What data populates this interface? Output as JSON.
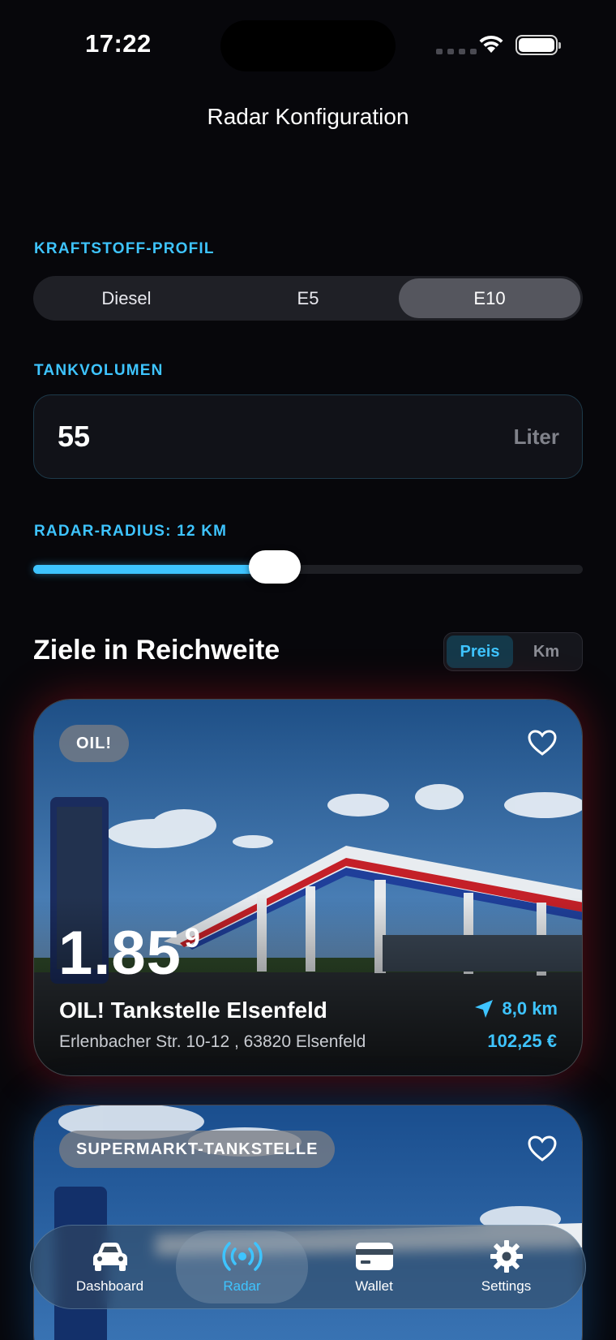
{
  "status_bar": {
    "time": "17:22"
  },
  "header": {
    "title": "Radar Konfiguration"
  },
  "fuel_profile": {
    "label": "KRAFTSTOFF-PROFIL",
    "options": [
      "Diesel",
      "E5",
      "E10"
    ],
    "selected": "E10"
  },
  "tank": {
    "label": "TANKVOLUMEN",
    "value": "55",
    "unit": "Liter"
  },
  "radius": {
    "label": "RADAR-RADIUS: 12 KM",
    "fill_fraction": 0.44
  },
  "targets": {
    "title": "Ziele in Reichweite",
    "sort_options": [
      "Preis",
      "Km"
    ],
    "sort_selected": "Preis"
  },
  "stations": [
    {
      "brand": "OIL!",
      "price_main": "1.85",
      "price_sup": "9",
      "name": "OIL! Tankstelle Elsenfeld",
      "address": "Erlenbacher Str. 10-12 , 63820 Elsenfeld",
      "distance": "8,0 km",
      "cost": "102,25 €",
      "favorite_icon": "heart-outline-icon",
      "accent": "#c41e2a"
    },
    {
      "brand": "SUPERMARKT-TANKSTELLE",
      "favorite_icon": "heart-outline-icon",
      "accent": "#1565c0"
    }
  ],
  "tabbar": {
    "tabs": [
      {
        "label": "Dashboard",
        "icon": "car-icon"
      },
      {
        "label": "Radar",
        "icon": "radar-icon"
      },
      {
        "label": "Wallet",
        "icon": "wallet-card-icon"
      },
      {
        "label": "Settings",
        "icon": "gear-icon"
      }
    ],
    "active": "Radar"
  },
  "colors": {
    "accent": "#3ec4ff",
    "background": "#07070b"
  }
}
